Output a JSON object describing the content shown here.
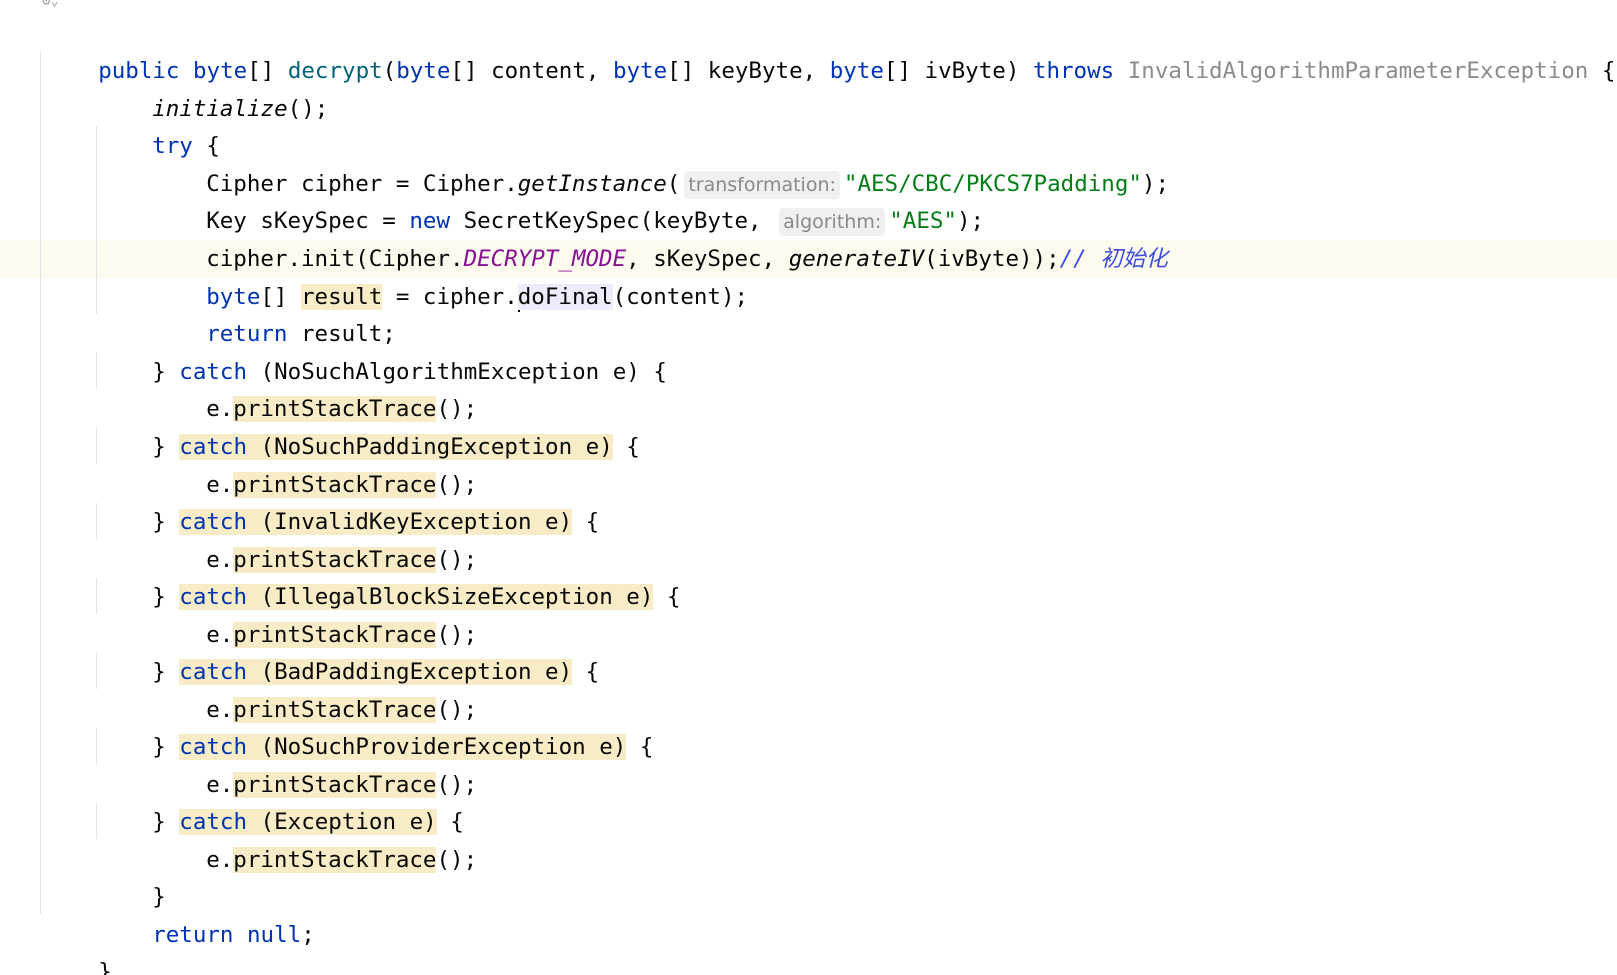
{
  "colors": {
    "keyword": "#0033b3",
    "method_declaration": "#00627a",
    "string": "#067d17",
    "constant": "#871094",
    "comment": "#3d4fe0",
    "highlight": "#f8ecc6",
    "current_line": "#fdfaee"
  },
  "gutter": {
    "icon": "annotation-gutter-icon"
  },
  "code": {
    "line1": {
      "public_kw": "public",
      "byte1": "byte",
      "brackets1": "[] ",
      "method": "decrypt",
      "paren_open": "(",
      "byte2": "byte",
      "params_a": "[] content, ",
      "byte3": "byte",
      "params_b": "[] keyByte, ",
      "byte4": "byte",
      "params_c": "[] ivByte) ",
      "throws_kw": "throws",
      "exception": "InvalidAlgorithmParameterException",
      "brace": " {"
    },
    "line2": {
      "call": "initialize",
      "rest": "();"
    },
    "line3": {
      "try_kw": "try",
      "rest": " {"
    },
    "line4": {
      "prefix": "Cipher cipher = Cipher.",
      "call": "getInstance",
      "paren": "(",
      "hint": "transformation:",
      "string": "\"AES/CBC/PKCS7Padding\"",
      "rest": ");"
    },
    "line5": {
      "prefix": "Key sKeySpec = ",
      "new_kw": "new",
      "middle": " SecretKeySpec(keyByte, ",
      "hint": "algorithm:",
      "string": "\"AES\"",
      "rest": ");"
    },
    "line6": {
      "prefix": "cipher.init(Cipher.",
      "constant": "DECRYPT_MODE",
      "middle": ", sKeySpec, ",
      "call": "generateIV",
      "rest": "(ivByte));",
      "comment": "// 初始化"
    },
    "line7": {
      "byte_kw": "byte",
      "brackets": "[] ",
      "result": "result",
      "middle": " = cipher.",
      "call": "doFinal",
      "rest": "(content);"
    },
    "line8": {
      "return_kw": "return",
      "rest": " result;"
    },
    "catches": [
      {
        "close": "} ",
        "catch_kw": "catch",
        "clause": " (NoSuchAlgorithmException e)",
        "brace": " {",
        "highlighted": false
      },
      {
        "close": "} ",
        "catch_kw": "catch",
        "clause": " (NoSuchPaddingException e)",
        "brace": " {",
        "highlighted": true
      },
      {
        "close": "} ",
        "catch_kw": "catch",
        "clause": " (InvalidKeyException e)",
        "brace": " {",
        "highlighted": true
      },
      {
        "close": "} ",
        "catch_kw": "catch",
        "clause": " (IllegalBlockSizeException e)",
        "brace": " {",
        "highlighted": true
      },
      {
        "close": "} ",
        "catch_kw": "catch",
        "clause": " (BadPaddingException e)",
        "brace": " {",
        "highlighted": true
      },
      {
        "close": "} ",
        "catch_kw": "catch",
        "clause": " (NoSuchProviderException e)",
        "brace": " {",
        "highlighted": true
      },
      {
        "close": "} ",
        "catch_kw": "catch",
        "clause": " (Exception e)",
        "brace": " {",
        "highlighted": true
      }
    ],
    "print_stmt": {
      "receiver": "e.",
      "call": "printStackTrace",
      "rest": "();"
    },
    "closing_try": "}",
    "final_return": {
      "return_kw": "return",
      "null_kw": "null",
      "semicolon": ";"
    },
    "closing_method": "}"
  }
}
